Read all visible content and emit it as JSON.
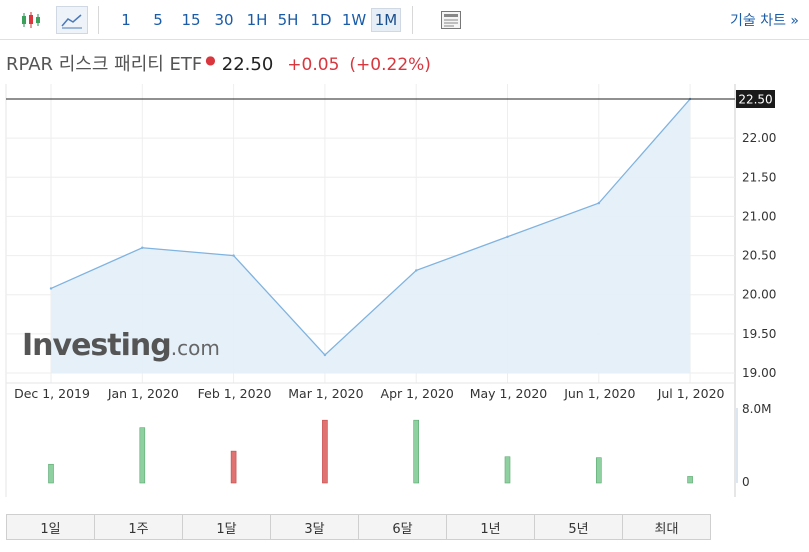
{
  "toolbar": {
    "intervals": [
      "1",
      "5",
      "15",
      "30",
      "1H",
      "5H",
      "1D",
      "1W",
      "1M"
    ],
    "active_interval": "1M",
    "advanced_chart_label": "기술 차트 »"
  },
  "header": {
    "name": "RPAR 리스크 패리티 ETF",
    "price": "22.50",
    "change": "+0.05",
    "change_pct": "(+0.22%)"
  },
  "watermark": {
    "main": "Investing",
    "domain": ".com"
  },
  "colors": {
    "line": "#7fb3e0",
    "area": "#e3eef8",
    "up": "#8fd0a0",
    "down": "#e07272",
    "text_red": "#d9363e"
  },
  "range_buttons": [
    "1일",
    "1주",
    "1달",
    "3달",
    "6달",
    "1년",
    "5년",
    "최대"
  ],
  "chart_data": {
    "type": "area",
    "x": [
      "Dec 1, 2019",
      "Jan 1, 2020",
      "Feb 1, 2020",
      "Mar 1, 2020",
      "Apr 1, 2020",
      "May 1, 2020",
      "Jun 1, 2020",
      "Jul 1, 2020"
    ],
    "values": [
      20.08,
      20.6,
      20.5,
      19.23,
      20.31,
      20.74,
      21.17,
      22.5
    ],
    "ylim": [
      19.0,
      22.5
    ],
    "y_ticks": [
      "19.00",
      "19.50",
      "20.00",
      "20.50",
      "21.00",
      "21.50",
      "22.00"
    ],
    "last_value_label": "22.50",
    "volume": {
      "values": [
        2.0,
        5.9,
        3.4,
        6.7,
        6.7,
        2.8,
        2.7,
        0.7
      ],
      "directions": [
        "up",
        "up",
        "down",
        "down",
        "up",
        "up",
        "up",
        "up"
      ],
      "ylim": [
        0,
        8
      ],
      "top_label": "8.0M",
      "bottom_label": "0"
    },
    "grid": true
  }
}
